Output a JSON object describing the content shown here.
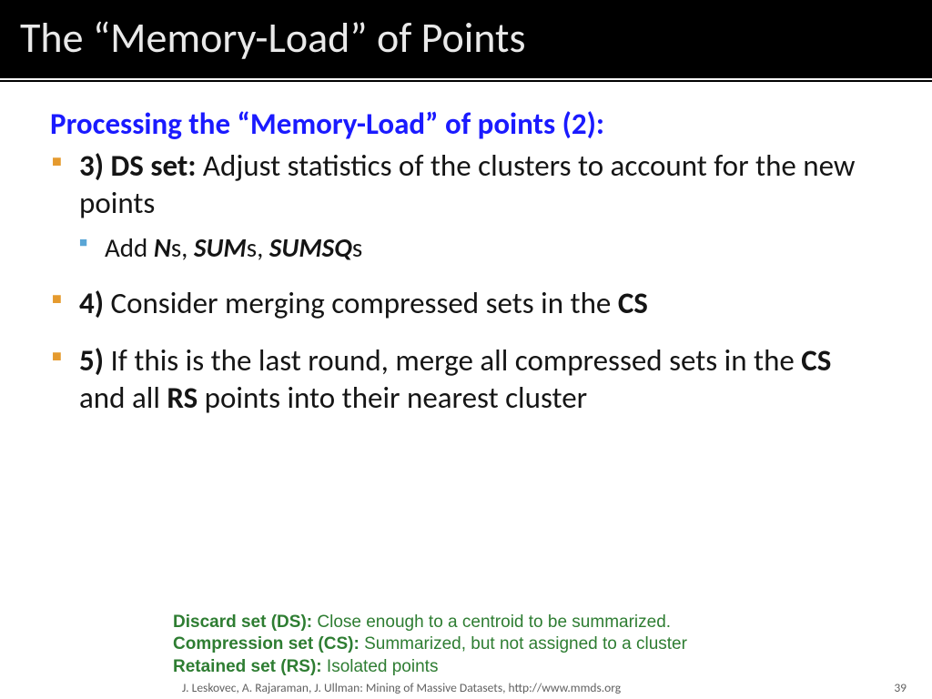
{
  "title": "The “Memory-Load” of Points",
  "subhead": "Processing the “Memory-Load” of points (2):",
  "bullets": {
    "b3": {
      "num": "3) DS set:",
      "text": " Adjust statistics of the clusters to account for the new points",
      "sub_prefix": "Add ",
      "n": "N",
      "s1": "s, ",
      "sum": "SUM",
      "s2": "s, ",
      "sumsq": "SUMSQ",
      "s3": "s"
    },
    "b4": {
      "num": "4)",
      "text": " Consider merging compressed sets in the ",
      "cs": "CS"
    },
    "b5": {
      "num": "5)",
      "t1": " If this is the last round, merge all compressed sets in the ",
      "cs": "CS",
      "t2": " and all ",
      "rs": "RS",
      "t3": " points into their nearest cluster"
    }
  },
  "legend": {
    "ds_lbl": "Discard set (DS):",
    "ds_txt": "  Close enough to a centroid to be summarized.",
    "cs_lbl": "Compression set (CS):",
    "cs_txt": "  Summarized, but not assigned to a cluster",
    "rs_lbl": "Retained set (RS):",
    "rs_txt": " Isolated points"
  },
  "footer": {
    "credit": "J. Leskovec, A. Rajaraman, J. Ullman: Mining of Massive Datasets, http://www.mmds.org",
    "page": "39"
  }
}
